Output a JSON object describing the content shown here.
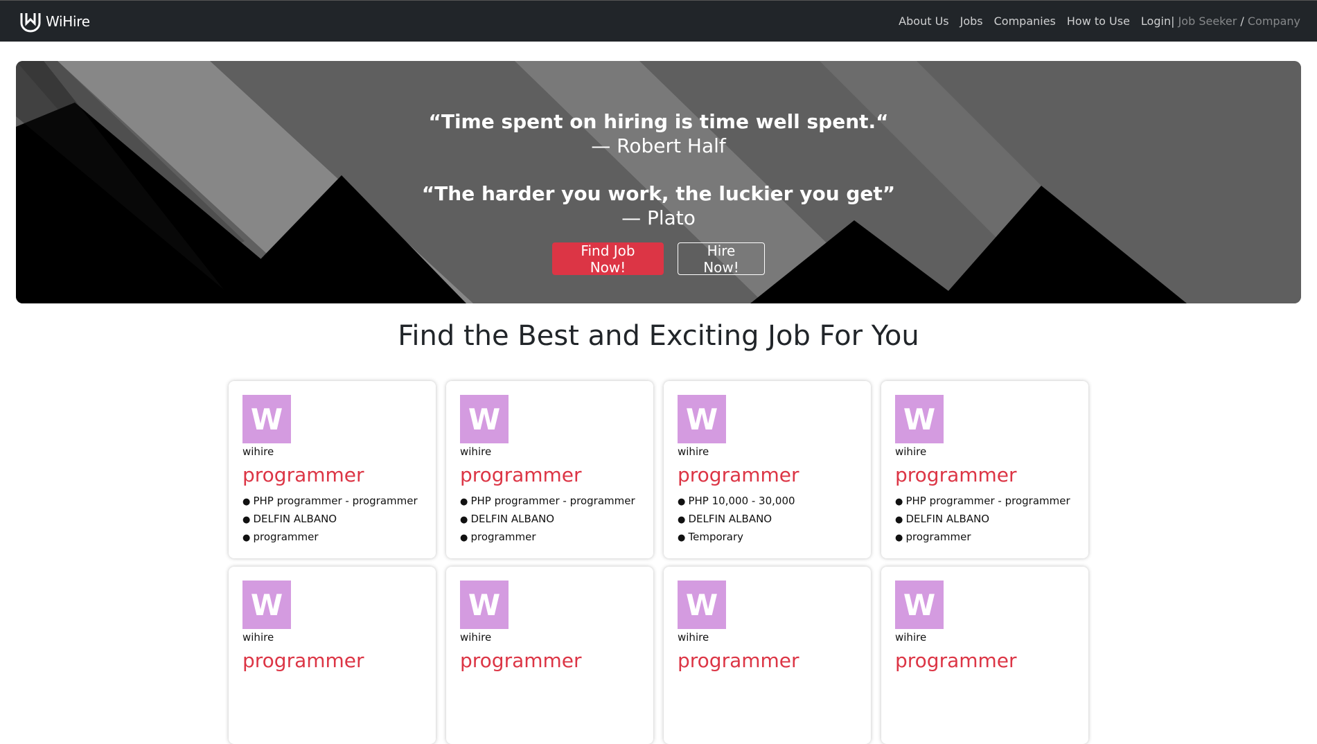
{
  "navbar": {
    "brand": "WiHire",
    "links": [
      "About Us",
      "Jobs",
      "Companies",
      "How to Use"
    ],
    "login_label": "Login",
    "separator": "|",
    "job_seeker": "Job Seeker",
    "slash": "/",
    "company": "Company",
    "logo_icon": "wihire-logo-icon"
  },
  "hero": {
    "quote1": "“Time spent on hiring is time well spent.“",
    "author1": "— Robert Half",
    "quote2": "“The harder you work, the luckier you get”",
    "author2": "— Plato",
    "find_job_button": "Find Job Now!",
    "hire_button": "Hire Now!"
  },
  "section": {
    "title": "Find the Best and Exciting Job For You"
  },
  "jobs": [
    {
      "logo_letter": "W",
      "company": "wihire",
      "title": "programmer",
      "lines": [
        "PHP programmer - programmer",
        "DELFIN ALBANO",
        "programmer"
      ]
    },
    {
      "logo_letter": "W",
      "company": "wihire",
      "title": "programmer",
      "lines": [
        "PHP programmer - programmer",
        "DELFIN ALBANO",
        "programmer"
      ]
    },
    {
      "logo_letter": "W",
      "company": "wihire",
      "title": "programmer",
      "lines": [
        "PHP 10,000 - 30,000",
        "DELFIN ALBANO",
        "Temporary"
      ]
    },
    {
      "logo_letter": "W",
      "company": "wihire",
      "title": "programmer",
      "lines": [
        "PHP programmer - programmer",
        "DELFIN ALBANO",
        "programmer"
      ]
    },
    {
      "logo_letter": "W",
      "company": "wihire",
      "title": "programmer",
      "lines": []
    },
    {
      "logo_letter": "W",
      "company": "wihire",
      "title": "programmer",
      "lines": []
    },
    {
      "logo_letter": "W",
      "company": "wihire",
      "title": "programmer",
      "lines": []
    },
    {
      "logo_letter": "W",
      "company": "wihire",
      "title": "programmer",
      "lines": []
    }
  ],
  "colors": {
    "navbar_bg": "#212529",
    "accent_red": "#dc3545",
    "company_logo_bg": "#d49be0"
  }
}
